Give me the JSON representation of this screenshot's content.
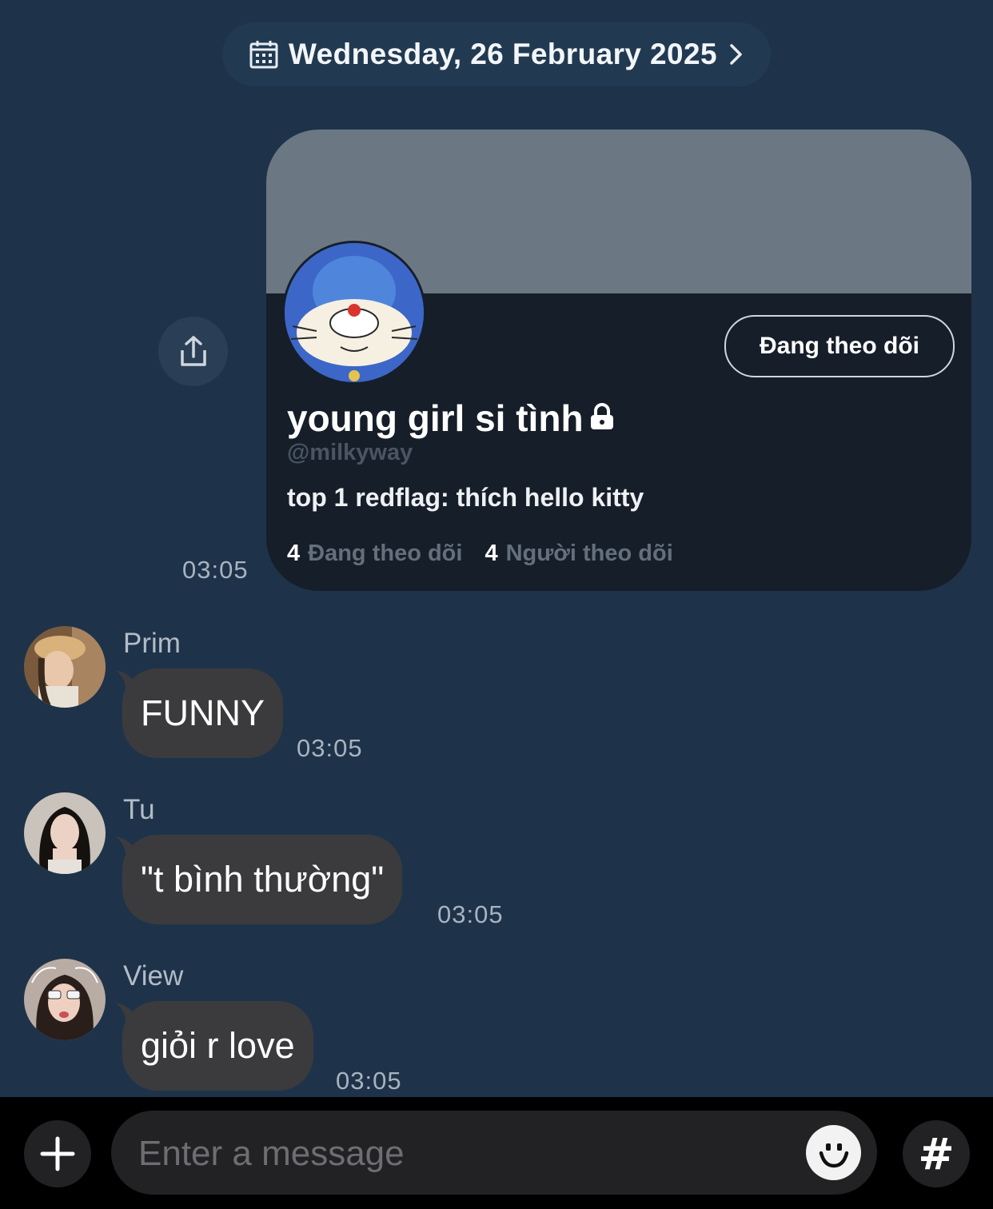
{
  "date_header": {
    "label": "Wednesday, 26 February 2025",
    "icon": "calendar-icon",
    "chevron_icon": "chevron-right-icon"
  },
  "shared_profile": {
    "time": "03:05",
    "share_icon": "share-icon",
    "display_name": "young girl si tình",
    "lock_icon": "lock-icon",
    "handle": "@milkyway",
    "bio": "top 1 redflag: thích hello kitty",
    "follow_button": "Đang theo dõi",
    "following_count": "4",
    "following_label": "Đang theo dõi",
    "followers_count": "4",
    "followers_label": "Người theo dõi"
  },
  "messages": [
    {
      "sender": "Prim",
      "text": "FUNNY",
      "time": "03:05"
    },
    {
      "sender": "Tu",
      "text": "\"t bình thường\"",
      "time": "03:05"
    },
    {
      "sender": "View",
      "text": "giỏi r love",
      "time": "03:05"
    }
  ],
  "composer": {
    "placeholder": "Enter a message",
    "add_icon": "plus-icon",
    "emoji_icon": "emoji-icon",
    "hashtag_label": "#"
  },
  "colors": {
    "background": "#1e3349",
    "bubble": "#3b3b3e",
    "card": "#161e29",
    "banner": "#6b7883"
  }
}
